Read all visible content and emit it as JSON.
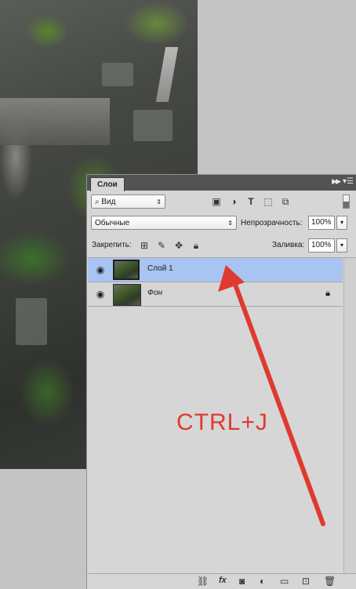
{
  "canvas": {
    "description_icon": "photo-canvas"
  },
  "panel": {
    "tab_label": "Слои",
    "collapse_icon": "double-chevron-right-icon",
    "menu_icon": "panel-menu-icon",
    "filter": {
      "value": "Вид",
      "icon": "search-icon"
    },
    "filter_icons": [
      "image-filter-icon",
      "adjustment-filter-icon",
      "type-filter-icon",
      "shape-filter-icon",
      "smart-object-filter-icon"
    ],
    "blend_mode": "Обычные",
    "opacity_label": "Непрозрачность:",
    "opacity_value": "100%",
    "lock_label": "Закрепить:",
    "lock_icons": [
      "lock-transparent-icon",
      "lock-image-icon",
      "lock-position-icon",
      "lock-all-icon"
    ],
    "fill_label": "Заливка:",
    "fill_value": "100%",
    "layers": [
      {
        "name": "Слой 1",
        "active": true
      },
      {
        "name": "Фон",
        "active": false,
        "locked": true
      }
    ],
    "footer_icons": [
      "link-icon",
      "fx-icon",
      "mask-icon",
      "adjustment-icon",
      "folder-icon",
      "new-layer-icon",
      "trash-icon"
    ],
    "footer_fx": "fx"
  },
  "annotation": {
    "text": "CTRL+J",
    "color": "#e03a30"
  }
}
